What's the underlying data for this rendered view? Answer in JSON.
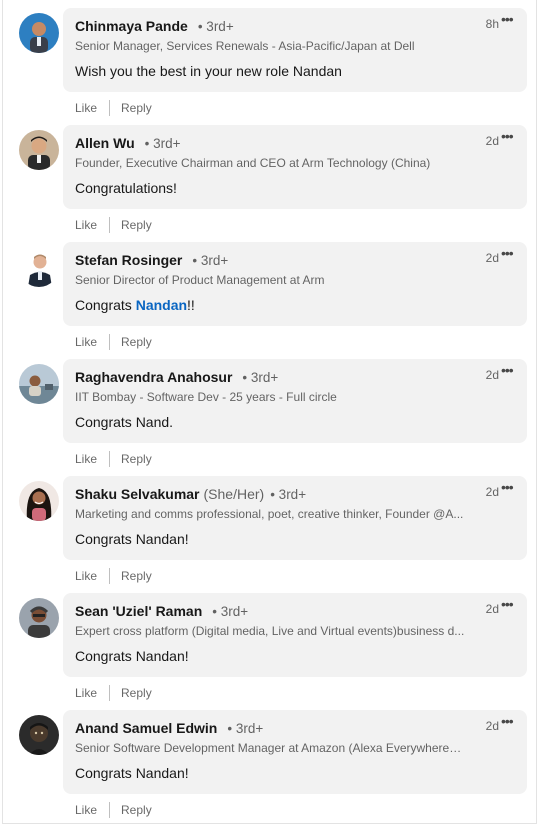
{
  "actions": {
    "like": "Like",
    "reply": "Reply"
  },
  "comments": [
    {
      "name": "Chinmaya Pande",
      "pronoun": "",
      "degree": "• 3rd+",
      "headline": "Senior Manager, Services Renewals - Asia-Pacific/Japan at Dell",
      "time": "8h",
      "text_before": "Wish you the best in your new role Nandan",
      "mention": "",
      "text_after": "",
      "avatar_bg": "#2d7fc1"
    },
    {
      "name": "Allen Wu",
      "pronoun": "",
      "degree": "• 3rd+",
      "headline": "Founder, Executive Chairman and CEO at Arm Technology (China)",
      "time": "2d",
      "text_before": "Congratulations!",
      "mention": "",
      "text_after": "",
      "avatar_bg": "#c9b49a"
    },
    {
      "name": "Stefan Rosinger",
      "pronoun": "",
      "degree": "• 3rd+",
      "headline": "Senior Director of Product Management at Arm",
      "time": "2d",
      "text_before": "Congrats ",
      "mention": "Nandan",
      "text_after": "!!",
      "avatar_bg": "#ffffff"
    },
    {
      "name": "Raghavendra Anahosur",
      "pronoun": "",
      "degree": "• 3rd+",
      "headline": "IIT Bombay - Software Dev - 25 years - Full circle",
      "time": "2d",
      "text_before": "Congrats Nand.",
      "mention": "",
      "text_after": "",
      "avatar_bg": "#7c93a8"
    },
    {
      "name": "Shaku Selvakumar",
      "pronoun": "(She/Her)",
      "degree": "• 3rd+",
      "headline": "Marketing and comms professional, poet, creative thinker, Founder @A...",
      "time": "2d",
      "text_before": "Congrats Nandan!",
      "mention": "",
      "text_after": "",
      "avatar_bg": "#f0e8e4"
    },
    {
      "name": "Sean 'Uziel' Raman",
      "pronoun": "",
      "degree": "• 3rd+",
      "headline": "Expert cross platform (Digital media, Live and Virtual events)business d...",
      "time": "2d",
      "text_before": "Congrats Nandan!",
      "mention": "",
      "text_after": "",
      "avatar_bg": "#9aa3ad"
    },
    {
      "name": "Anand Samuel Edwin",
      "pronoun": "",
      "degree": "• 3rd+",
      "headline": "Senior Software Development Manager at Amazon (Alexa Everywhere), ...",
      "time": "2d",
      "text_before": "Congrats Nandan!",
      "mention": "",
      "text_after": "",
      "avatar_bg": "#2b2b2b"
    }
  ]
}
